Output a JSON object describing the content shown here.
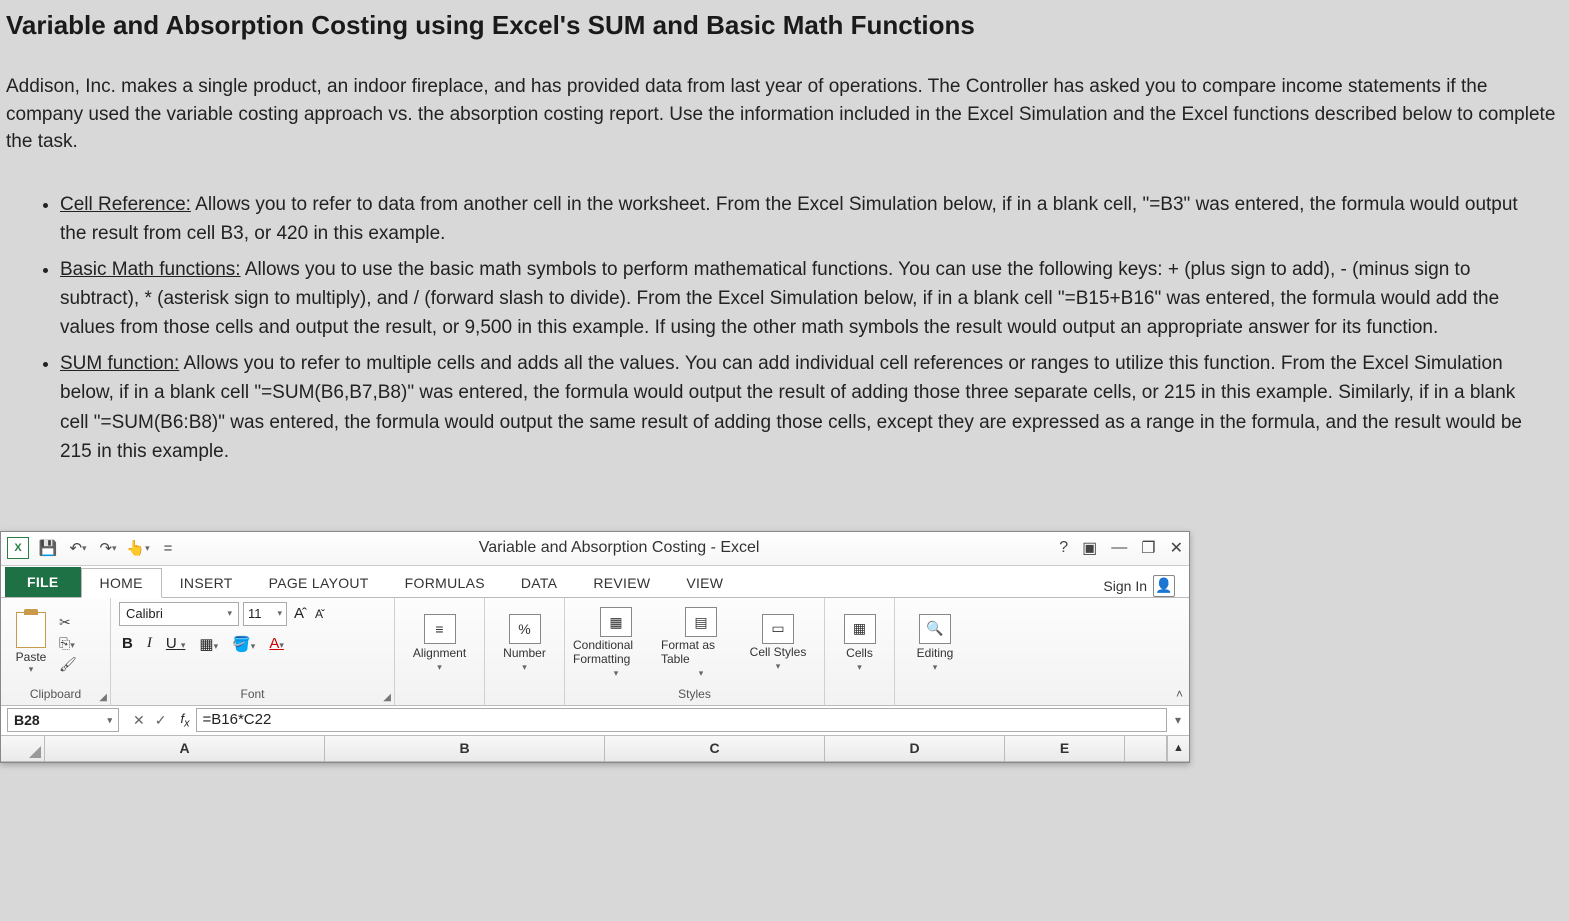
{
  "page": {
    "title": "Variable and Absorption Costing using Excel's SUM and Basic Math Functions",
    "intro": "Addison, Inc. makes a single product, an indoor fireplace, and has provided data from last year of operations.  The Controller has asked you to compare income statements if the company used the variable costing approach vs. the absorption costing report.  Use the information included in the Excel Simulation and the Excel functions described below to complete the task.",
    "bullets": [
      {
        "label": "Cell Reference:",
        "text": "  Allows you to refer to data from another cell in the worksheet.  From the Excel Simulation below, if in a blank cell, \"=B3\" was entered, the formula would output the result from cell B3, or 420 in this example."
      },
      {
        "label": "Basic Math functions:",
        "text": "  Allows you to use the basic math symbols to perform mathematical functions.  You can use the following keys: + (plus sign to add), - (minus sign to subtract), * (asterisk sign to multiply), and / (forward slash to divide).  From the Excel Simulation below, if in a blank cell \"=B15+B16\" was entered, the formula would add the values from those cells and output the result, or 9,500 in this example.  If using the other math symbols the result would output an appropriate answer for its function."
      },
      {
        "label": "SUM function:",
        "text": "  Allows you to refer to multiple cells and adds all the values.  You can add individual cell references or ranges to utilize this function.  From the Excel Simulation below, if in a blank cell \"=SUM(B6,B7,B8)\" was entered, the formula would output the result of adding those three separate cells, or 215 in this example.  Similarly, if in a blank cell \"=SUM(B6:B8)\" was entered, the formula would output the same result of adding those cells, except they are expressed as a range in the formula, and the result would be 215 in this example."
      }
    ]
  },
  "excel": {
    "doc_title": "Variable and Absorption Costing - Excel",
    "tabs": {
      "file": "FILE",
      "home": "HOME",
      "insert": "INSERT",
      "page_layout": "PAGE LAYOUT",
      "formulas": "FORMULAS",
      "data": "DATA",
      "review": "REVIEW",
      "view": "VIEW"
    },
    "sign_in": "Sign In",
    "ribbon": {
      "clipboard": {
        "label": "Clipboard",
        "paste": "Paste"
      },
      "font": {
        "label": "Font",
        "name": "Calibri",
        "size": "11",
        "increase": "Aˆ",
        "decrease": "Aˇ",
        "bold": "B",
        "italic": "I",
        "underline": "U"
      },
      "alignment": {
        "label": "Alignment"
      },
      "number": {
        "label": "Number",
        "percent": "%"
      },
      "styles": {
        "label": "Styles",
        "cond": "Conditional Formatting",
        "table": "Format as Table",
        "cell": "Cell Styles"
      },
      "cells": {
        "label": "Cells"
      },
      "editing": {
        "label": "Editing"
      }
    },
    "formula_bar": {
      "name_box": "B28",
      "formula": "=B16*C22"
    },
    "columns": [
      "A",
      "B",
      "C",
      "D",
      "E"
    ]
  }
}
